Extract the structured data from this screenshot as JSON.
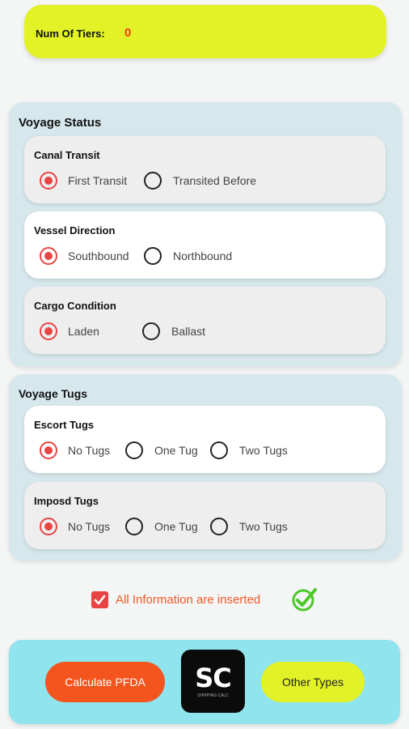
{
  "tiers": {
    "label": "Num Of Tiers:",
    "value": "0"
  },
  "voyage_status": {
    "title": "Voyage Status",
    "canal_transit": {
      "title": "Canal Transit",
      "options": [
        "First Transit",
        "Transited Before"
      ],
      "selected": 0
    },
    "vessel_direction": {
      "title": "Vessel Direction",
      "options": [
        "Southbound",
        "Northbound"
      ],
      "selected": 0
    },
    "cargo_condition": {
      "title": "Cargo Condition",
      "options": [
        "Laden",
        "Ballast"
      ],
      "selected": 0
    }
  },
  "voyage_tugs": {
    "title": "Voyage Tugs",
    "escort_tugs": {
      "title": "Escort Tugs",
      "options": [
        "No Tugs",
        "One Tug",
        "Two Tugs"
      ],
      "selected": 0
    },
    "imposed_tugs": {
      "title": "Imposd Tugs",
      "options": [
        "No Tugs",
        "One Tug",
        "Two Tugs"
      ],
      "selected": 0
    }
  },
  "confirmation": {
    "label": "All Information are inserted",
    "checked": true,
    "status_icon": "check-circle-icon"
  },
  "actions": {
    "calculate_label": "Calculate PFDA",
    "other_label": "Other Types",
    "logo_text": "SC",
    "logo_caption": "SHIPPING CALC"
  },
  "colors": {
    "accent_yellow": "#e2f226",
    "accent_orange": "#f4541e",
    "radio_red": "#e84444",
    "panel_blue": "#d7e8ed",
    "bottom_bar": "#8fe4ee",
    "check_green": "#4cc82b"
  }
}
